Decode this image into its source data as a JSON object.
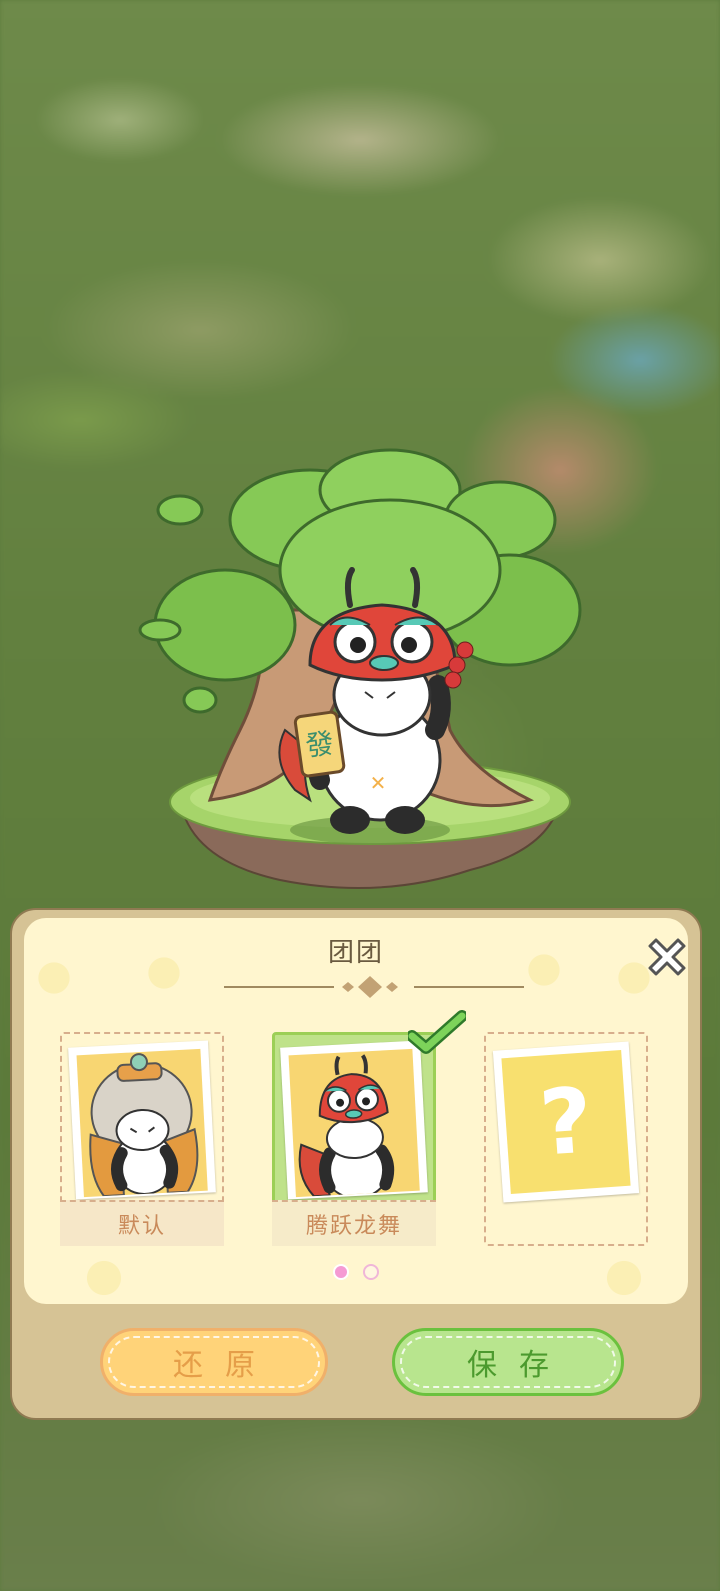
{
  "character_panel": {
    "title": "团团",
    "outfits": [
      {
        "label": "默认",
        "selected": false
      },
      {
        "label": "腾跃龙舞",
        "selected": true
      },
      {
        "label": "?",
        "locked": true
      }
    ],
    "pagination": {
      "current_page": 1,
      "total_pages": 2
    },
    "restore_label": "还原",
    "save_label": "保存"
  },
  "character_sign_text": "發",
  "colors": {
    "panel_bg": "#fff6cf",
    "restore_button": "#ffd379",
    "save_button": "#b8e58e",
    "selected_highlight": "#bfe28a",
    "active_dot": "#f59ad3"
  }
}
